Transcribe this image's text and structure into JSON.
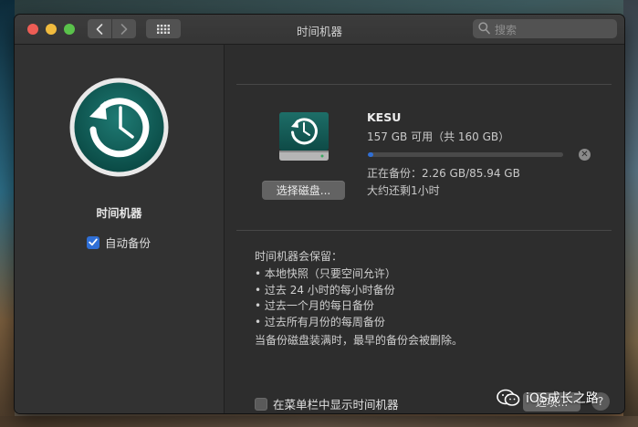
{
  "window": {
    "title": "时间机器"
  },
  "toolbar": {
    "back_icon": "chevron-left-icon",
    "forward_icon": "chevron-right-icon",
    "grid_icon": "grid-icon",
    "search_placeholder": "搜索"
  },
  "sidebar": {
    "app_icon": "time-machine-icon",
    "app_name": "时间机器",
    "auto_backup_label": "自动备份",
    "auto_backup_checked": true
  },
  "disk": {
    "name": "KESU",
    "capacity": "157 GB 可用（共 160 GB）",
    "select_button": "选择磁盘...",
    "progress_fraction": 0.026,
    "backup_status": "正在备份：2.26 GB/85.94 GB",
    "time_remaining": "大约还剩1小时"
  },
  "keeps": {
    "title": "时间机器会保留：",
    "items": [
      "• 本地快照（只要空间允许）",
      "• 过去 24 小时的每小时备份",
      "• 过去一个月的每日备份",
      "• 过去所有月份的每周备份"
    ],
    "note": "当备份磁盘装满时，最早的备份会被删除。"
  },
  "footer": {
    "menubar_label": "在菜单栏中显示时间机器",
    "menubar_checked": false,
    "options_button": "选项...",
    "help_button": "?"
  },
  "watermark": {
    "text": "iOS成长之路"
  },
  "colors": {
    "accent": "#2f6fd6",
    "close": "#ee5d55",
    "minimize": "#f1bb3e",
    "maximize": "#5ac24b",
    "window_bg": "#2b2b2b"
  }
}
